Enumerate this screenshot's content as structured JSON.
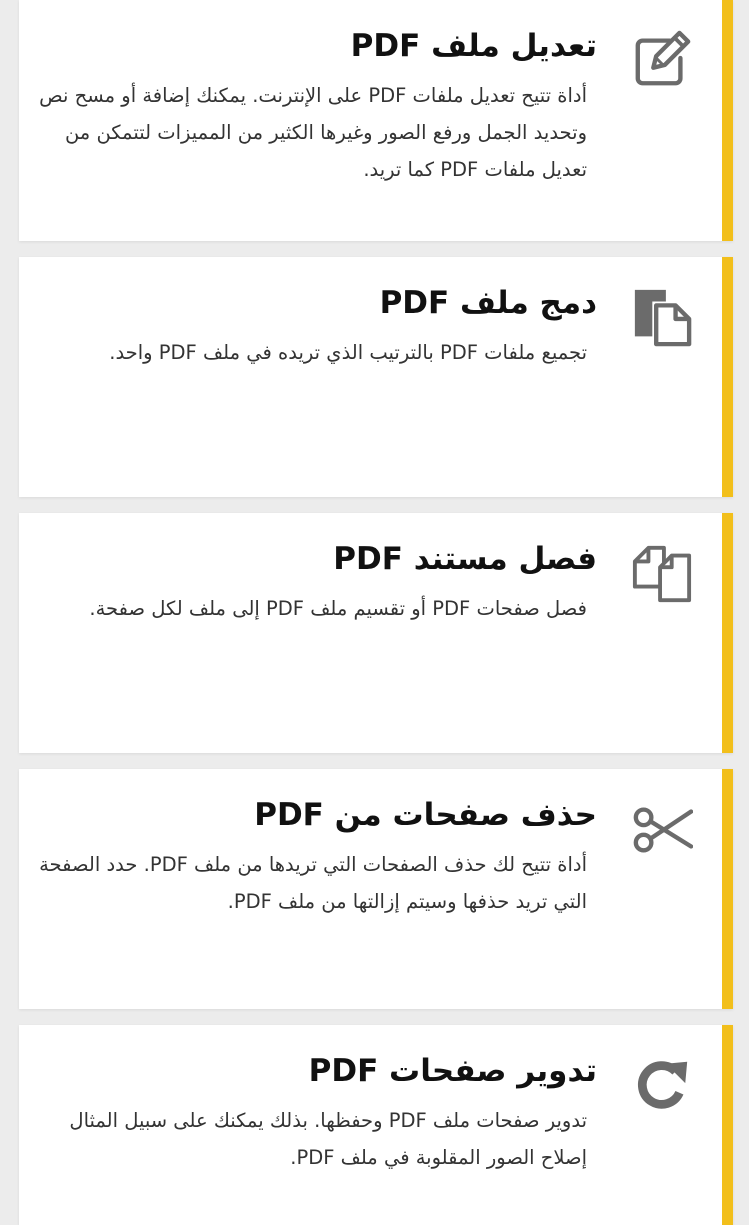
{
  "tools": [
    {
      "title": "تعديل ملف PDF",
      "description": "أداة تتيح تعديل ملفات PDF على الإنترنت. يمكنك إضافة أو مسح نص وتحديد الجمل ورفع الصور وغيرها الكثير من المميزات لتتمكن من تعديل ملفات PDF كما تريد.",
      "icon": "edit-icon"
    },
    {
      "title": "دمج ملف PDF",
      "description": "تجميع ملفات PDF بالترتيب الذي تريده في ملف PDF واحد.",
      "icon": "merge-icon"
    },
    {
      "title": "فصل مستند PDF",
      "description": "فصل صفحات PDF أو تقسيم ملف PDF إلى ملف لكل صفحة.",
      "icon": "split-icon"
    },
    {
      "title": "حذف صفحات من PDF",
      "description": "أداة تتيح لك حذف الصفحات التي تريدها من ملف PDF. حدد الصفحة التي تريد حذفها وسيتم إزالتها من ملف PDF.",
      "icon": "scissors-icon"
    },
    {
      "title": "تدوير صفحات PDF",
      "description": "تدوير صفحات ملف PDF وحفظها. بذلك يمكنك على سبيل المثال إصلاح الصور المقلوبة في ملف PDF.",
      "icon": "rotate-icon"
    }
  ],
  "colors": {
    "accent": "#f2bf1b",
    "icon": "#6b6b6b",
    "background": "#ececec"
  }
}
